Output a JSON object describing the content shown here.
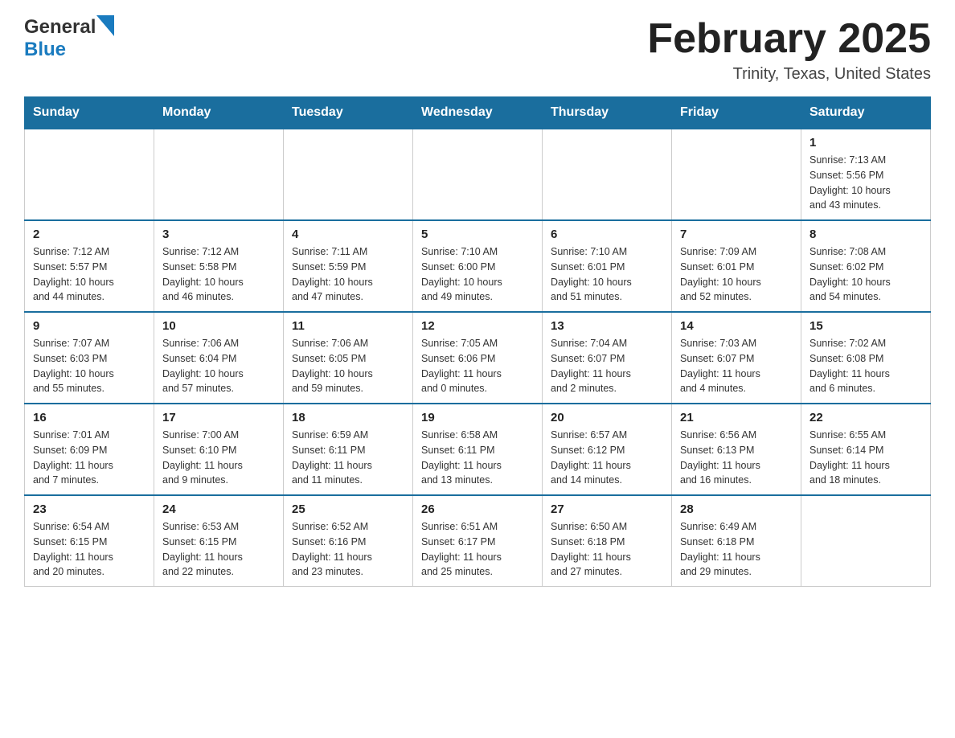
{
  "header": {
    "logo_general": "General",
    "logo_blue": "Blue",
    "title": "February 2025",
    "subtitle": "Trinity, Texas, United States"
  },
  "days_of_week": [
    "Sunday",
    "Monday",
    "Tuesday",
    "Wednesday",
    "Thursday",
    "Friday",
    "Saturday"
  ],
  "weeks": [
    {
      "cells": [
        {
          "day": "",
          "info": ""
        },
        {
          "day": "",
          "info": ""
        },
        {
          "day": "",
          "info": ""
        },
        {
          "day": "",
          "info": ""
        },
        {
          "day": "",
          "info": ""
        },
        {
          "day": "",
          "info": ""
        },
        {
          "day": "1",
          "info": "Sunrise: 7:13 AM\nSunset: 5:56 PM\nDaylight: 10 hours\nand 43 minutes."
        }
      ]
    },
    {
      "cells": [
        {
          "day": "2",
          "info": "Sunrise: 7:12 AM\nSunset: 5:57 PM\nDaylight: 10 hours\nand 44 minutes."
        },
        {
          "day": "3",
          "info": "Sunrise: 7:12 AM\nSunset: 5:58 PM\nDaylight: 10 hours\nand 46 minutes."
        },
        {
          "day": "4",
          "info": "Sunrise: 7:11 AM\nSunset: 5:59 PM\nDaylight: 10 hours\nand 47 minutes."
        },
        {
          "day": "5",
          "info": "Sunrise: 7:10 AM\nSunset: 6:00 PM\nDaylight: 10 hours\nand 49 minutes."
        },
        {
          "day": "6",
          "info": "Sunrise: 7:10 AM\nSunset: 6:01 PM\nDaylight: 10 hours\nand 51 minutes."
        },
        {
          "day": "7",
          "info": "Sunrise: 7:09 AM\nSunset: 6:01 PM\nDaylight: 10 hours\nand 52 minutes."
        },
        {
          "day": "8",
          "info": "Sunrise: 7:08 AM\nSunset: 6:02 PM\nDaylight: 10 hours\nand 54 minutes."
        }
      ]
    },
    {
      "cells": [
        {
          "day": "9",
          "info": "Sunrise: 7:07 AM\nSunset: 6:03 PM\nDaylight: 10 hours\nand 55 minutes."
        },
        {
          "day": "10",
          "info": "Sunrise: 7:06 AM\nSunset: 6:04 PM\nDaylight: 10 hours\nand 57 minutes."
        },
        {
          "day": "11",
          "info": "Sunrise: 7:06 AM\nSunset: 6:05 PM\nDaylight: 10 hours\nand 59 minutes."
        },
        {
          "day": "12",
          "info": "Sunrise: 7:05 AM\nSunset: 6:06 PM\nDaylight: 11 hours\nand 0 minutes."
        },
        {
          "day": "13",
          "info": "Sunrise: 7:04 AM\nSunset: 6:07 PM\nDaylight: 11 hours\nand 2 minutes."
        },
        {
          "day": "14",
          "info": "Sunrise: 7:03 AM\nSunset: 6:07 PM\nDaylight: 11 hours\nand 4 minutes."
        },
        {
          "day": "15",
          "info": "Sunrise: 7:02 AM\nSunset: 6:08 PM\nDaylight: 11 hours\nand 6 minutes."
        }
      ]
    },
    {
      "cells": [
        {
          "day": "16",
          "info": "Sunrise: 7:01 AM\nSunset: 6:09 PM\nDaylight: 11 hours\nand 7 minutes."
        },
        {
          "day": "17",
          "info": "Sunrise: 7:00 AM\nSunset: 6:10 PM\nDaylight: 11 hours\nand 9 minutes."
        },
        {
          "day": "18",
          "info": "Sunrise: 6:59 AM\nSunset: 6:11 PM\nDaylight: 11 hours\nand 11 minutes."
        },
        {
          "day": "19",
          "info": "Sunrise: 6:58 AM\nSunset: 6:11 PM\nDaylight: 11 hours\nand 13 minutes."
        },
        {
          "day": "20",
          "info": "Sunrise: 6:57 AM\nSunset: 6:12 PM\nDaylight: 11 hours\nand 14 minutes."
        },
        {
          "day": "21",
          "info": "Sunrise: 6:56 AM\nSunset: 6:13 PM\nDaylight: 11 hours\nand 16 minutes."
        },
        {
          "day": "22",
          "info": "Sunrise: 6:55 AM\nSunset: 6:14 PM\nDaylight: 11 hours\nand 18 minutes."
        }
      ]
    },
    {
      "cells": [
        {
          "day": "23",
          "info": "Sunrise: 6:54 AM\nSunset: 6:15 PM\nDaylight: 11 hours\nand 20 minutes."
        },
        {
          "day": "24",
          "info": "Sunrise: 6:53 AM\nSunset: 6:15 PM\nDaylight: 11 hours\nand 22 minutes."
        },
        {
          "day": "25",
          "info": "Sunrise: 6:52 AM\nSunset: 6:16 PM\nDaylight: 11 hours\nand 23 minutes."
        },
        {
          "day": "26",
          "info": "Sunrise: 6:51 AM\nSunset: 6:17 PM\nDaylight: 11 hours\nand 25 minutes."
        },
        {
          "day": "27",
          "info": "Sunrise: 6:50 AM\nSunset: 6:18 PM\nDaylight: 11 hours\nand 27 minutes."
        },
        {
          "day": "28",
          "info": "Sunrise: 6:49 AM\nSunset: 6:18 PM\nDaylight: 11 hours\nand 29 minutes."
        },
        {
          "day": "",
          "info": ""
        }
      ]
    }
  ]
}
